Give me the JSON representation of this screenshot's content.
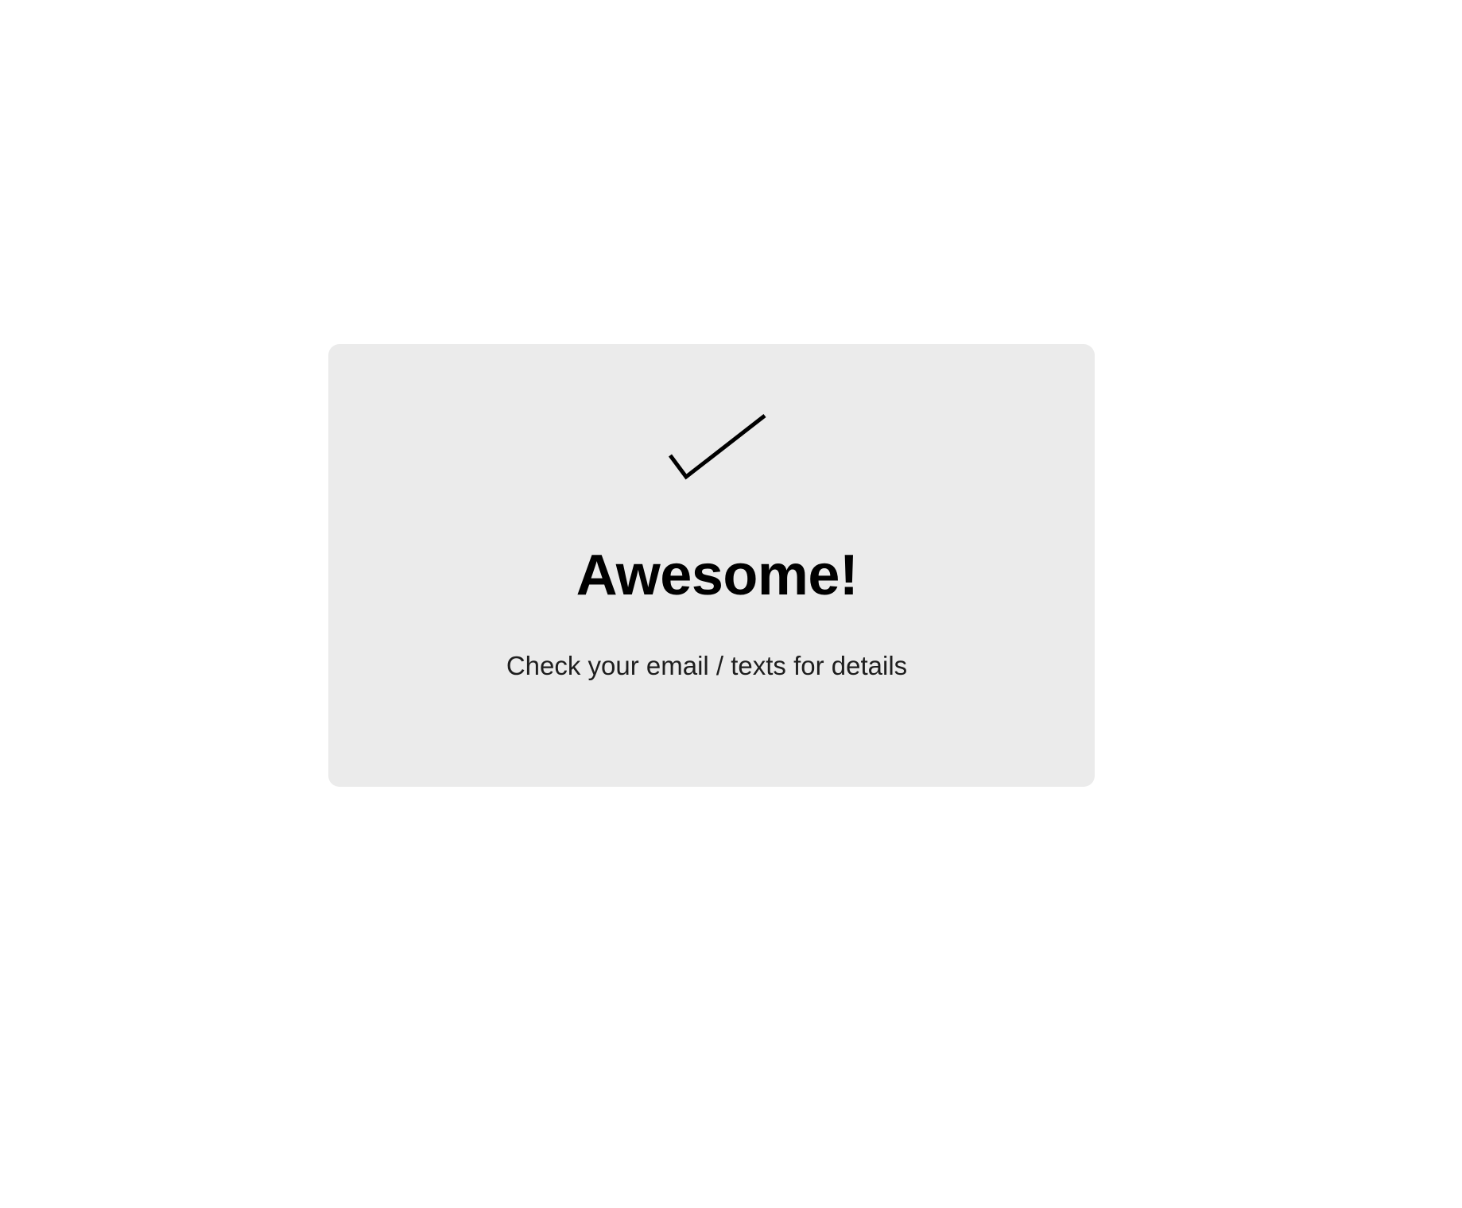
{
  "confirmation": {
    "icon": "checkmark-icon",
    "title": "Awesome!",
    "message": "Check your email / texts for details"
  },
  "colors": {
    "background": "#ffffff",
    "card": "#ebebeb",
    "text": "#000000"
  }
}
